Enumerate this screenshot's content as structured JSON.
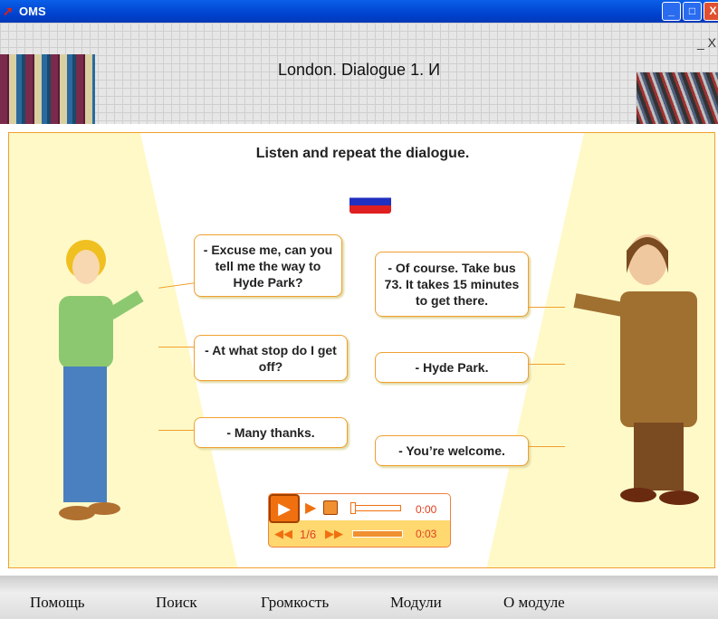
{
  "window": {
    "title": "OMS",
    "buttons": [
      "minimize",
      "maximize",
      "close"
    ]
  },
  "header": {
    "title": "London. Dialogue 1. И",
    "controls": {
      "minimize": "_",
      "close": "X"
    }
  },
  "stage": {
    "instruction": "Listen and repeat the dialogue.",
    "language_flag": "russian-flag",
    "left_bubbles": [
      "- Excuse me, can you tell me the way to Hyde Park?",
      "- At what stop do I get off?",
      "- Many thanks."
    ],
    "right_bubbles": [
      "- Of course. Take bus 73. It takes 15 minutes to get there.",
      "- Hyde Park.",
      "- You’re welcome."
    ]
  },
  "player": {
    "track": "1/6",
    "elapsed": "0:00",
    "duration": "0:03",
    "progress": 0,
    "volume": 1.0,
    "accent": "#f07010"
  },
  "nav": {
    "items": [
      "Помощь",
      "Поиск",
      "Громкость",
      "Модули",
      "О модуле"
    ]
  }
}
